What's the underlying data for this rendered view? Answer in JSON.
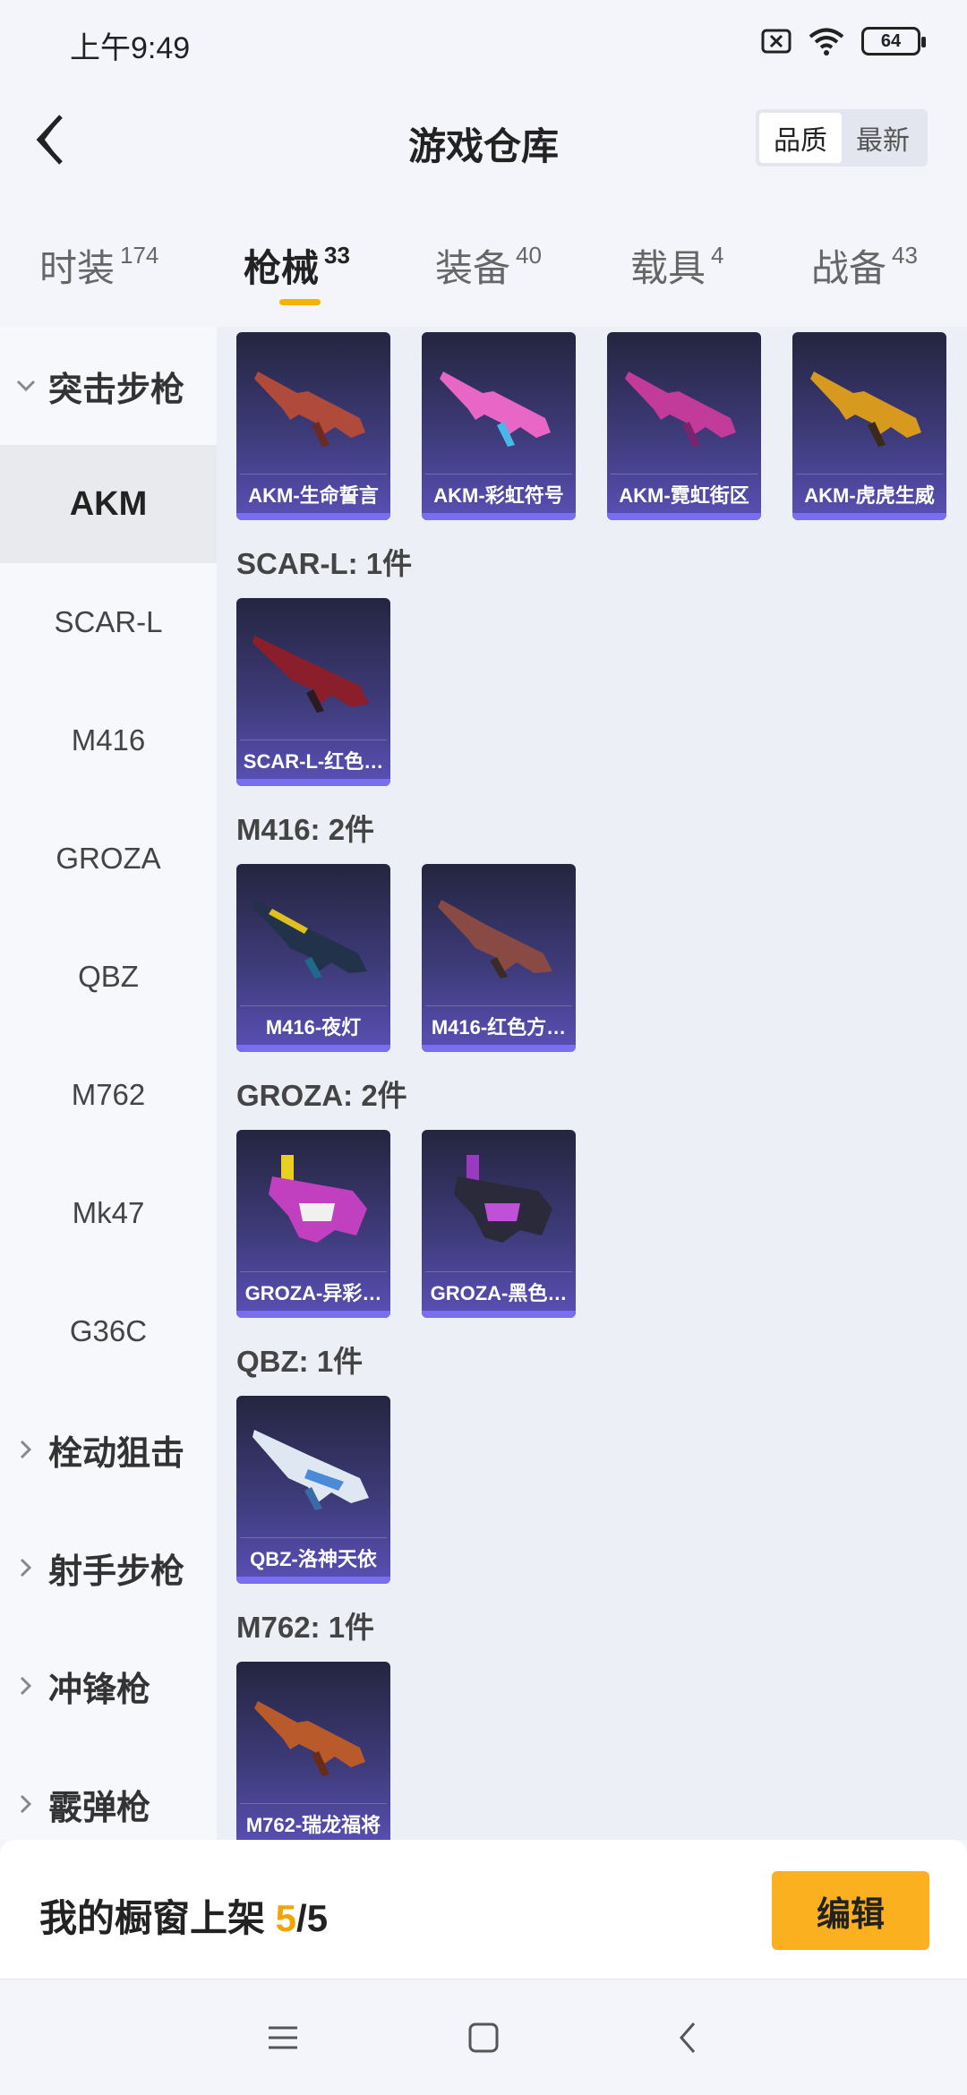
{
  "status_bar": {
    "time": "上午9:49",
    "battery": "64"
  },
  "header": {
    "title": "游戏仓库",
    "sort_options": [
      "品质",
      "最新"
    ]
  },
  "tabs": [
    {
      "label": "时装",
      "count": "174"
    },
    {
      "label": "枪械",
      "count": "33"
    },
    {
      "label": "装备",
      "count": "40"
    },
    {
      "label": "载具",
      "count": "4"
    },
    {
      "label": "战备",
      "count": "43"
    }
  ],
  "sidebar": {
    "category_expanded": "突击步枪",
    "items": [
      "AKM",
      "SCAR-L",
      "M416",
      "GROZA",
      "QBZ",
      "M762",
      "Mk47",
      "G36C"
    ],
    "categories": [
      "栓动狙击",
      "射手步枪",
      "冲锋枪",
      "霰弹枪"
    ]
  },
  "groups": [
    {
      "title": "",
      "items": [
        "AKM-生命誓言",
        "AKM-彩虹符号",
        "AKM-霓虹街区",
        "AKM-虎虎生威"
      ]
    },
    {
      "title": "SCAR-L: 1件",
      "items": [
        "SCAR-L-红色…"
      ]
    },
    {
      "title": "M416: 2件",
      "items": [
        "M416-夜灯",
        "M416-红色方…"
      ]
    },
    {
      "title": "GROZA: 2件",
      "items": [
        "GROZA-异彩…",
        "GROZA-黑色…"
      ]
    },
    {
      "title": "QBZ: 1件",
      "items": [
        "QBZ-洛神天依"
      ]
    },
    {
      "title": "M762: 1件",
      "items": [
        "M762-瑞龙福将"
      ]
    }
  ],
  "footer": {
    "shelf_label": "我的橱窗上架 ",
    "shelf_current": "5",
    "shelf_total": "/5",
    "edit_label": "编辑"
  },
  "colors": {
    "accent": "#f5b300",
    "card_top": "#24253f",
    "card_bottom": "#5a50b6"
  }
}
